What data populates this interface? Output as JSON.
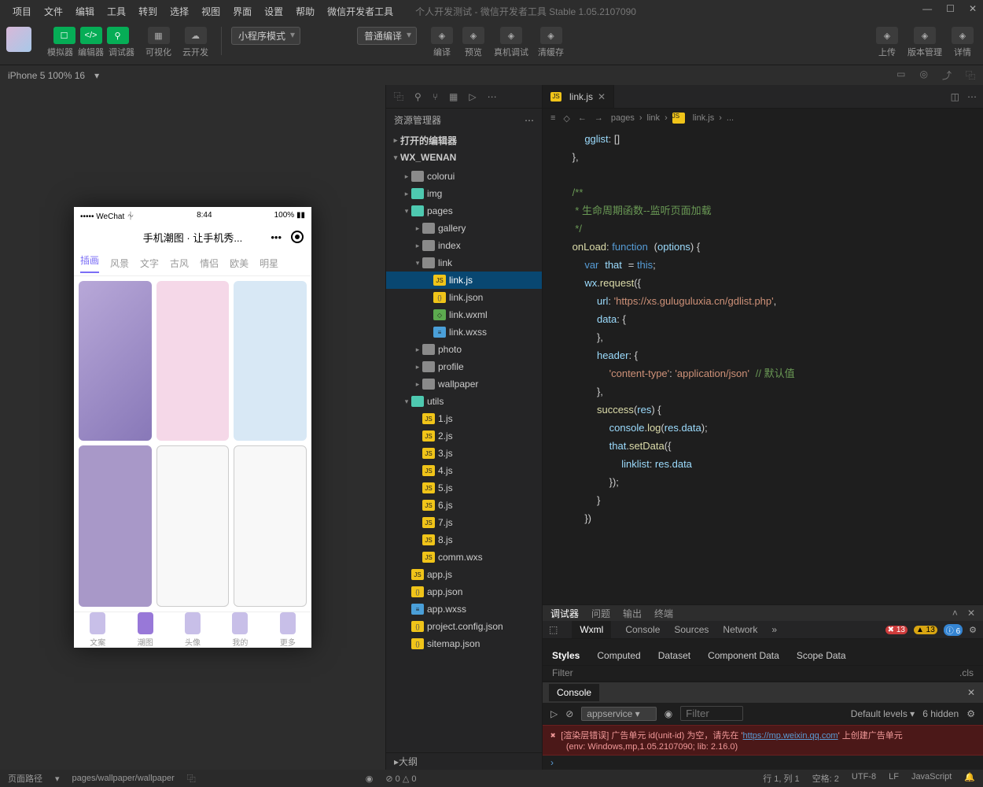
{
  "menu": [
    "项目",
    "文件",
    "编辑",
    "工具",
    "转到",
    "选择",
    "视图",
    "界面",
    "设置",
    "帮助",
    "微信开发者工具"
  ],
  "window_title": "个人开发测试 - 微信开发者工具 Stable 1.05.2107090",
  "toolbar": {
    "sim": "模拟器",
    "editor": "编辑器",
    "debug": "调试器",
    "visual": "可视化",
    "cloud": "云开发",
    "mode": "小程序模式",
    "compile": "普通编译",
    "actions": [
      "编译",
      "预览",
      "真机调试",
      "清缓存"
    ],
    "right": [
      "上传",
      "版本管理",
      "详情"
    ]
  },
  "device": {
    "label": "iPhone 5 100% 16",
    "signal": "▾"
  },
  "phone": {
    "carrier": "WeChat",
    "time": "8:44",
    "battery": "100%",
    "title": "手机潮图 · 让手机秀...",
    "tabs": [
      "插画",
      "风景",
      "文字",
      "古风",
      "情侣",
      "欧美",
      "明星"
    ],
    "nav": [
      "文案",
      "潮图",
      "头像",
      "我的",
      "更多"
    ]
  },
  "explorer": {
    "header": "资源管理器",
    "sections": [
      "打开的编辑器",
      "WX_WENAN"
    ],
    "tree": [
      {
        "l": "colorui",
        "t": "folder",
        "d": 1
      },
      {
        "l": "img",
        "t": "fgreen",
        "d": 1
      },
      {
        "l": "pages",
        "t": "fgreen",
        "d": 1,
        "open": true
      },
      {
        "l": "gallery",
        "t": "folder",
        "d": 2
      },
      {
        "l": "index",
        "t": "folder",
        "d": 2
      },
      {
        "l": "link",
        "t": "folder",
        "d": 2,
        "open": true
      },
      {
        "l": "link.js",
        "t": "js",
        "d": 3,
        "sel": true
      },
      {
        "l": "link.json",
        "t": "json",
        "d": 3
      },
      {
        "l": "link.wxml",
        "t": "wxml",
        "d": 3
      },
      {
        "l": "link.wxss",
        "t": "wxss",
        "d": 3
      },
      {
        "l": "photo",
        "t": "folder",
        "d": 2
      },
      {
        "l": "profile",
        "t": "folder",
        "d": 2
      },
      {
        "l": "wallpaper",
        "t": "folder",
        "d": 2
      },
      {
        "l": "utils",
        "t": "fgreen",
        "d": 1,
        "open": true
      },
      {
        "l": "1.js",
        "t": "js",
        "d": 2
      },
      {
        "l": "2.js",
        "t": "js",
        "d": 2
      },
      {
        "l": "3.js",
        "t": "js",
        "d": 2
      },
      {
        "l": "4.js",
        "t": "js",
        "d": 2
      },
      {
        "l": "5.js",
        "t": "js",
        "d": 2
      },
      {
        "l": "6.js",
        "t": "js",
        "d": 2
      },
      {
        "l": "7.js",
        "t": "js",
        "d": 2
      },
      {
        "l": "8.js",
        "t": "js",
        "d": 2
      },
      {
        "l": "comm.wxs",
        "t": "js",
        "d": 2
      },
      {
        "l": "app.js",
        "t": "js",
        "d": 1
      },
      {
        "l": "app.json",
        "t": "json",
        "d": 1
      },
      {
        "l": "app.wxss",
        "t": "wxss",
        "d": 1
      },
      {
        "l": "project.config.json",
        "t": "json",
        "d": 1
      },
      {
        "l": "sitemap.json",
        "t": "json",
        "d": 1
      }
    ],
    "outline": "大纲"
  },
  "editor_tab": "link.js",
  "crumbs": [
    "pages",
    "link",
    "link.js",
    "..."
  ],
  "code": {
    "c1": "生命周期函数--监听页面加载",
    "url": "https://xs.guluguluxia.cn/gdlist.php",
    "ct": "content-type",
    "app": "application/json",
    "def": "默认值"
  },
  "devtools": {
    "top": [
      "调试器",
      "问题",
      "输出",
      "终端"
    ],
    "tabs": [
      "Wxml",
      "Console",
      "Sources",
      "Network"
    ],
    "err": "13",
    "warn": "13",
    "info": "6",
    "styles": [
      "Styles",
      "Computed",
      "Dataset",
      "Component Data",
      "Scope Data"
    ],
    "filter": "Filter",
    "cls": ".cls"
  },
  "console": {
    "tab": "Console",
    "ctx": "appservice",
    "filter": "Filter",
    "levels": "Default levels",
    "hidden": "6 hidden",
    "msg1": "[渲染层错误] 广告单元 id(unit-id) 为空，请先在 '",
    "link": "https://mp.weixin.qq.com",
    "msg1b": "' 上创建广告单元",
    "msg2": "(env: Windows,mp,1.05.2107090; lib: 2.16.0)"
  },
  "status": {
    "path_lbl": "页面路径",
    "path": "pages/wallpaper/wallpaper",
    "counts": "⊘ 0 △ 0",
    "pos": "行 1, 列 1",
    "spaces": "空格: 2",
    "enc": "UTF-8",
    "eol": "LF",
    "lang": "JavaScript"
  }
}
